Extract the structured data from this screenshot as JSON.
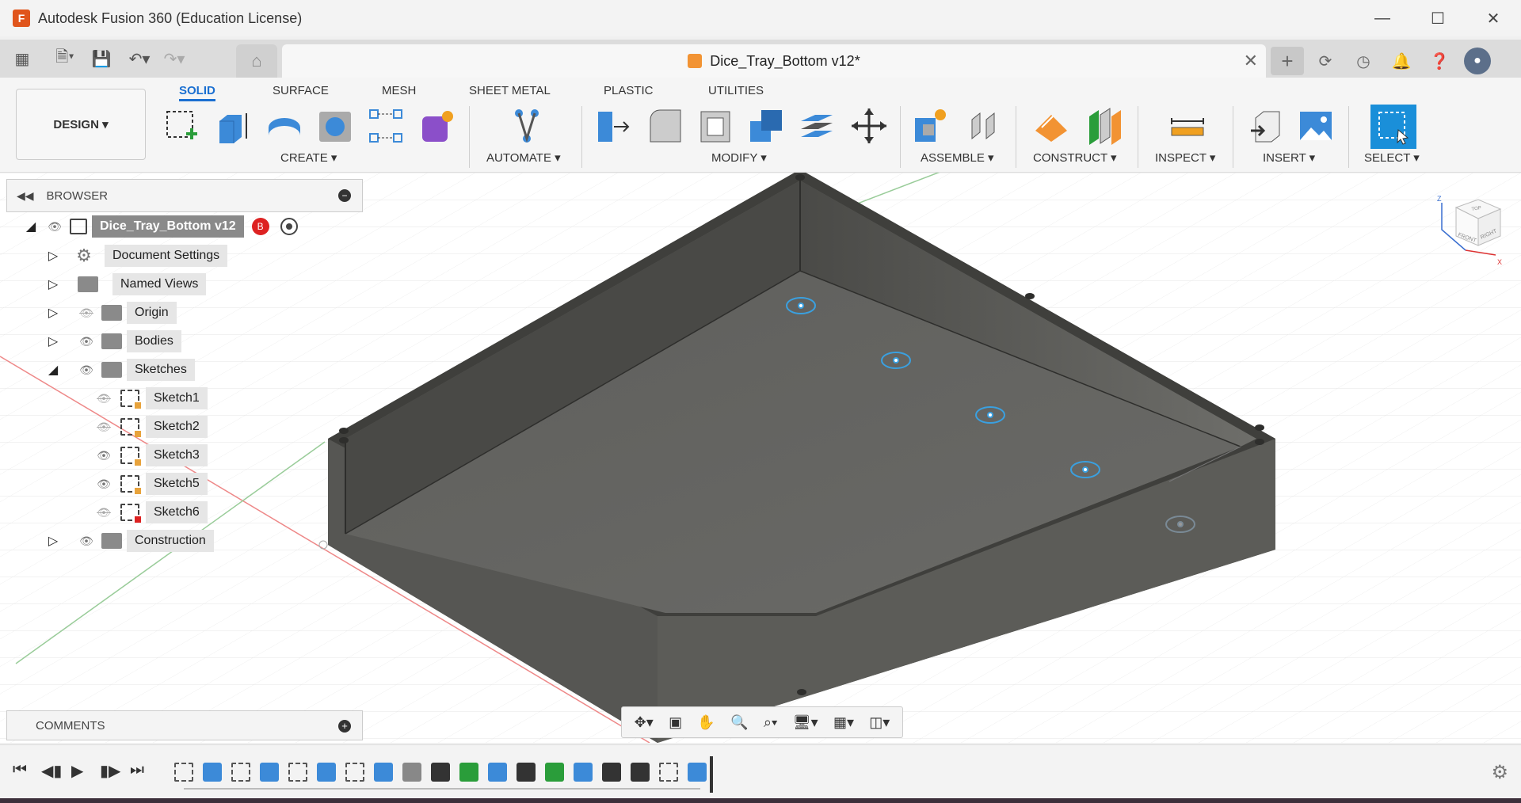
{
  "window": {
    "title": "Autodesk Fusion 360 (Education License)",
    "logo_letter": "F"
  },
  "document_tab": {
    "name": "Dice_Tray_Bottom v12*"
  },
  "ribbon": {
    "workspace": "DESIGN",
    "tabs": [
      "SOLID",
      "SURFACE",
      "MESH",
      "SHEET METAL",
      "PLASTIC",
      "UTILITIES"
    ],
    "groups": [
      "CREATE",
      "AUTOMATE",
      "MODIFY",
      "ASSEMBLE",
      "CONSTRUCT",
      "INSPECT",
      "INSERT",
      "SELECT"
    ]
  },
  "browser": {
    "title": "BROWSER",
    "root": "Dice_Tray_Bottom v12",
    "items": [
      {
        "label": "Document Settings"
      },
      {
        "label": "Named Views"
      },
      {
        "label": "Origin"
      },
      {
        "label": "Bodies"
      },
      {
        "label": "Sketches"
      },
      {
        "label": "Sketch1"
      },
      {
        "label": "Sketch2"
      },
      {
        "label": "Sketch3"
      },
      {
        "label": "Sketch5"
      },
      {
        "label": "Sketch6"
      },
      {
        "label": "Construction"
      }
    ]
  },
  "comments": {
    "title": "COMMENTS"
  },
  "viewcube": {
    "face_left": "FRONT",
    "face_right": "RIGHT",
    "face_top": "TOP"
  },
  "colors": {
    "accent": "#1a6fd1",
    "body": "#5b5b58",
    "body_dark": "#3a3a38"
  }
}
